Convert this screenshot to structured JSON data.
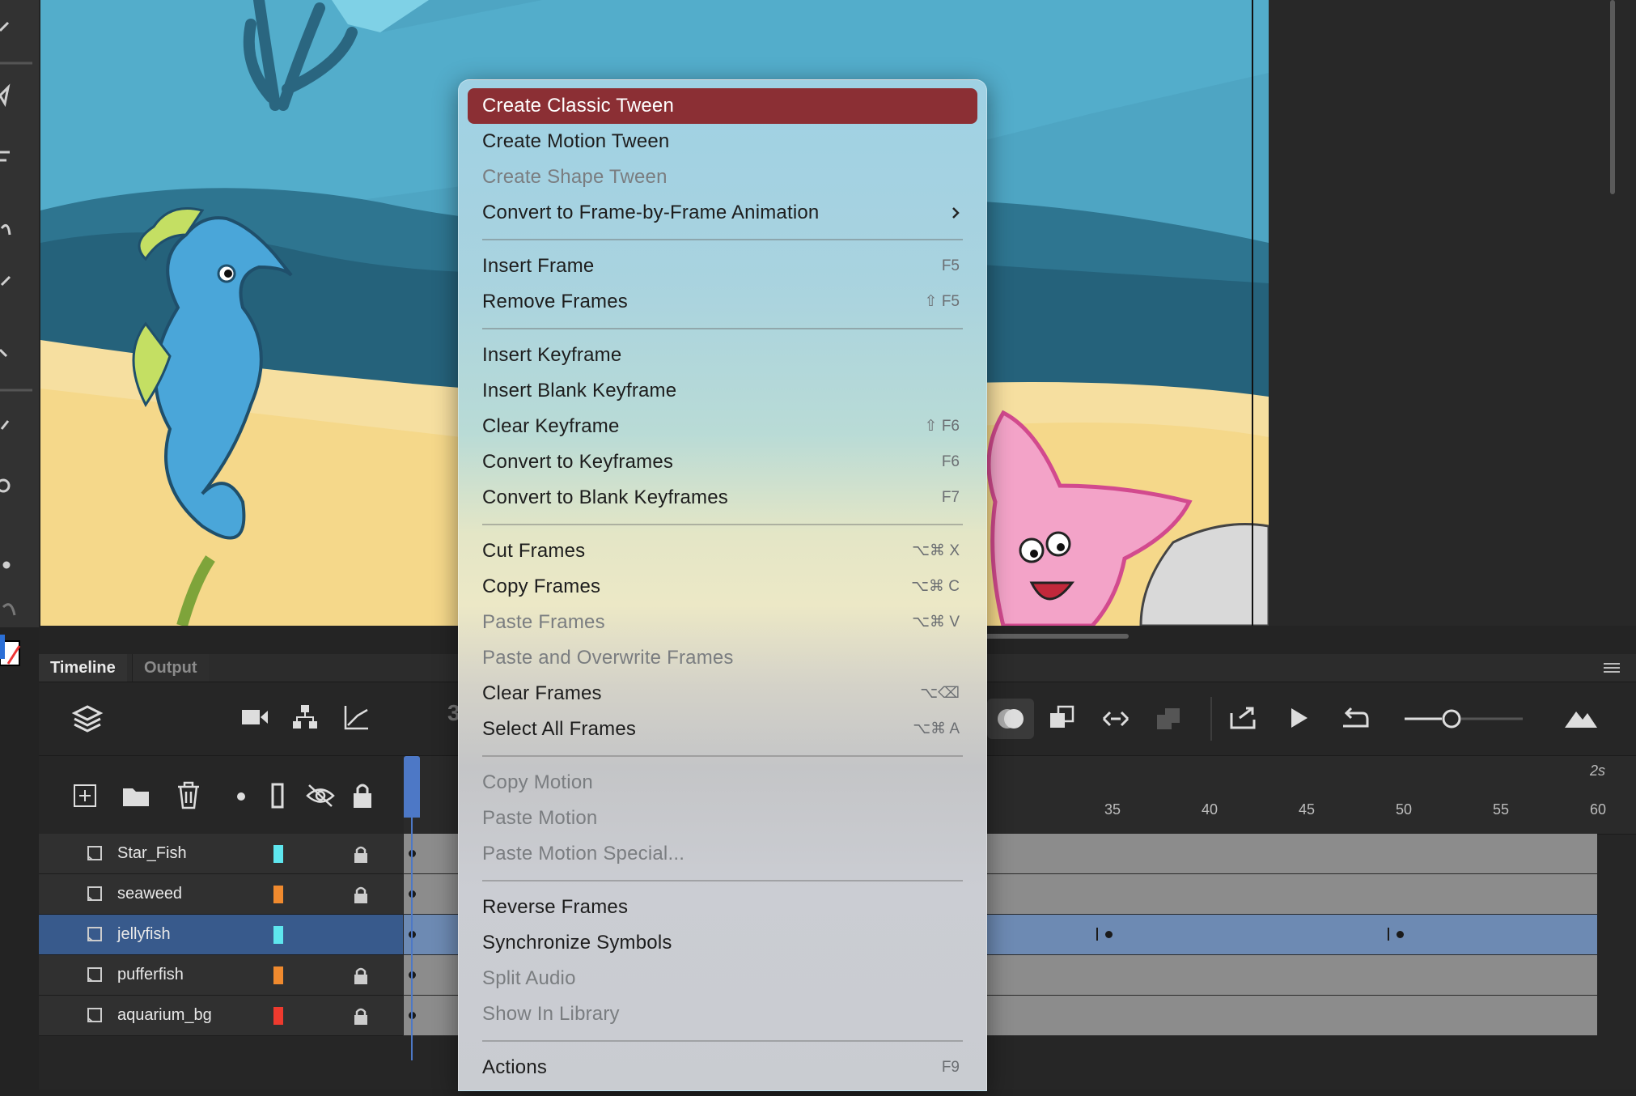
{
  "context_menu": {
    "items": [
      {
        "label": "Create Classic Tween",
        "shortcut": "",
        "state": "highlighted"
      },
      {
        "label": "Create Motion Tween",
        "shortcut": "",
        "state": "enabled"
      },
      {
        "label": "Create Shape Tween",
        "shortcut": "",
        "state": "disabled"
      },
      {
        "label": "Convert to Frame-by-Frame Animation",
        "shortcut": "",
        "state": "enabled",
        "submenu": true
      },
      {
        "label": "Insert Frame",
        "shortcut": "F5",
        "state": "enabled"
      },
      {
        "label": "Remove Frames",
        "shortcut": "⇧ F5",
        "state": "enabled"
      },
      {
        "label": "Insert Keyframe",
        "shortcut": "",
        "state": "enabled"
      },
      {
        "label": "Insert Blank Keyframe",
        "shortcut": "",
        "state": "enabled"
      },
      {
        "label": "Clear Keyframe",
        "shortcut": "⇧ F6",
        "state": "enabled"
      },
      {
        "label": "Convert to Keyframes",
        "shortcut": "F6",
        "state": "enabled"
      },
      {
        "label": "Convert to Blank Keyframes",
        "shortcut": "F7",
        "state": "enabled"
      },
      {
        "label": "Cut Frames",
        "shortcut": "⌥⌘ X",
        "state": "enabled"
      },
      {
        "label": "Copy Frames",
        "shortcut": "⌥⌘ C",
        "state": "enabled"
      },
      {
        "label": "Paste Frames",
        "shortcut": "⌥⌘ V",
        "state": "disabled"
      },
      {
        "label": "Paste and Overwrite Frames",
        "shortcut": "",
        "state": "disabled"
      },
      {
        "label": "Clear Frames",
        "shortcut": "⌥⌫",
        "state": "enabled"
      },
      {
        "label": "Select All Frames",
        "shortcut": "⌥⌘ A",
        "state": "enabled"
      },
      {
        "label": "Copy Motion",
        "shortcut": "",
        "state": "disabled"
      },
      {
        "label": "Paste Motion",
        "shortcut": "",
        "state": "disabled"
      },
      {
        "label": "Paste Motion Special...",
        "shortcut": "",
        "state": "disabled"
      },
      {
        "label": "Reverse Frames",
        "shortcut": "",
        "state": "enabled"
      },
      {
        "label": "Synchronize Symbols",
        "shortcut": "",
        "state": "enabled"
      },
      {
        "label": "Split Audio",
        "shortcut": "",
        "state": "disabled"
      },
      {
        "label": "Show In Library",
        "shortcut": "",
        "state": "disabled"
      },
      {
        "label": "Actions",
        "shortcut": "F9",
        "state": "enabled"
      }
    ]
  },
  "panel": {
    "tabs": [
      "Timeline",
      "Output"
    ],
    "active_tab": "Timeline"
  },
  "ruler": {
    "labels": [
      "35",
      "40",
      "45",
      "50",
      "55",
      "60"
    ],
    "seconds_label": "2s",
    "partial_frame_label": "3"
  },
  "layers": [
    {
      "name": "Star_Fish",
      "color": "#5ee6ee",
      "locked": true,
      "selected": false
    },
    {
      "name": "seaweed",
      "color": "#f08a2e",
      "locked": true,
      "selected": false
    },
    {
      "name": "jellyfish",
      "color": "#5ee6ee",
      "locked": false,
      "selected": true
    },
    {
      "name": "pufferfish",
      "color": "#f08a2e",
      "locked": true,
      "selected": false
    },
    {
      "name": "aquarium_bg",
      "color": "#ee3a2e",
      "locked": true,
      "selected": false
    }
  ],
  "colors": {
    "menu_highlight": "#8b2f34",
    "selected_layer": "#385a8c",
    "playhead": "#4d78c6"
  }
}
